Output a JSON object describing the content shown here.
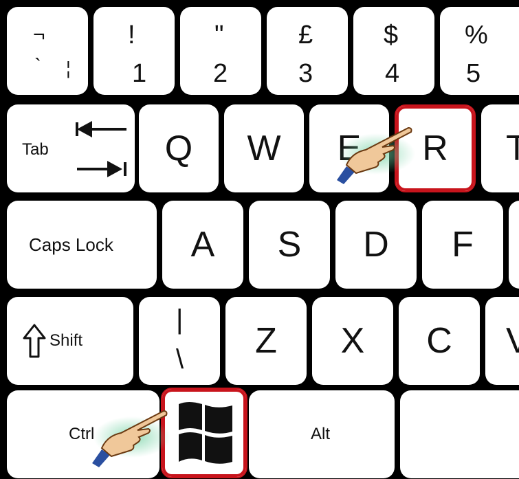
{
  "keys": {
    "row1": [
      {
        "id": "backtick",
        "top": "¬",
        "bottom": "`",
        "extra": "¦"
      },
      {
        "id": "1",
        "top": "!",
        "bottom": "1"
      },
      {
        "id": "2",
        "top": "\"",
        "bottom": "2"
      },
      {
        "id": "3",
        "top": "£",
        "bottom": "3"
      },
      {
        "id": "4",
        "top": "$",
        "bottom": "4"
      },
      {
        "id": "5",
        "top": "%",
        "bottom": "5"
      }
    ],
    "tab": "Tab",
    "q": "Q",
    "w": "W",
    "e": "E",
    "r": "R",
    "t": "T",
    "caps": "Caps Lock",
    "a": "A",
    "s": "S",
    "d": "D",
    "f": "F",
    "shift": "Shift",
    "backslash_top": "|",
    "backslash_bottom": "\\",
    "z": "Z",
    "x": "X",
    "c": "C",
    "v": "V",
    "ctrl": "Ctrl",
    "alt": "Alt"
  },
  "highlight_color": "#c8141c"
}
